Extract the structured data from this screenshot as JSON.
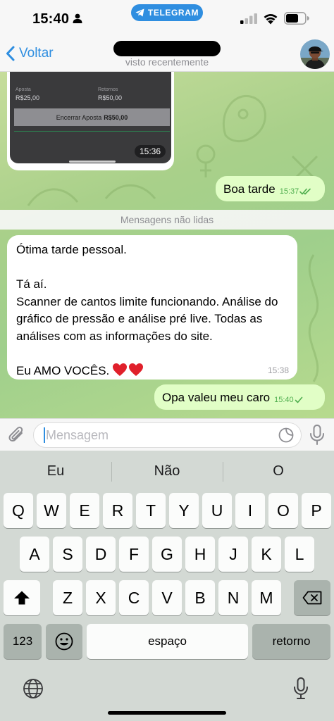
{
  "status_bar": {
    "time": "15:40",
    "active_app_pill": "TELEGRAM"
  },
  "header": {
    "back_label": "Voltar",
    "contact_status": "visto recentemente"
  },
  "chat": {
    "screenshot_message": {
      "bet_label": "Aposta",
      "bet_value": "R$25,00",
      "returns_label": "Retornos",
      "returns_value": "R$50,00",
      "cashout_label": "Encerrar Aposta",
      "cashout_value": "R$50,00",
      "time": "15:36"
    },
    "outgoing_1": {
      "text": "Boa tarde",
      "time": "15:37"
    },
    "unread_banner": "Mensagens não lidas",
    "incoming": {
      "text": "Ótima tarde pessoal.\n\nTá aí.\nScanner de cantos limite funcionando. Análise do gráfico de pressão e análise pré live. Todas as análises com as informações do site.\n\nEu AMO VOCÊS.",
      "time": "15:38"
    },
    "outgoing_2": {
      "text": "Opa valeu meu caro",
      "time": "15:40"
    }
  },
  "input": {
    "placeholder": "Mensagem"
  },
  "keyboard": {
    "suggestions": [
      "Eu",
      "Não",
      "O"
    ],
    "row1": [
      "Q",
      "W",
      "E",
      "R",
      "T",
      "Y",
      "U",
      "I",
      "O",
      "P"
    ],
    "row2": [
      "A",
      "S",
      "D",
      "F",
      "G",
      "H",
      "J",
      "K",
      "L"
    ],
    "row3": [
      "Z",
      "X",
      "C",
      "V",
      "B",
      "N",
      "M"
    ],
    "numbers_label": "123",
    "space_label": "espaço",
    "return_label": "retorno"
  },
  "colors": {
    "accent": "#2f8ee0",
    "outgoing_bubble": "#e1fec6",
    "read_check": "#4fae4e",
    "chat_wallpaper": "#a9d08a"
  }
}
